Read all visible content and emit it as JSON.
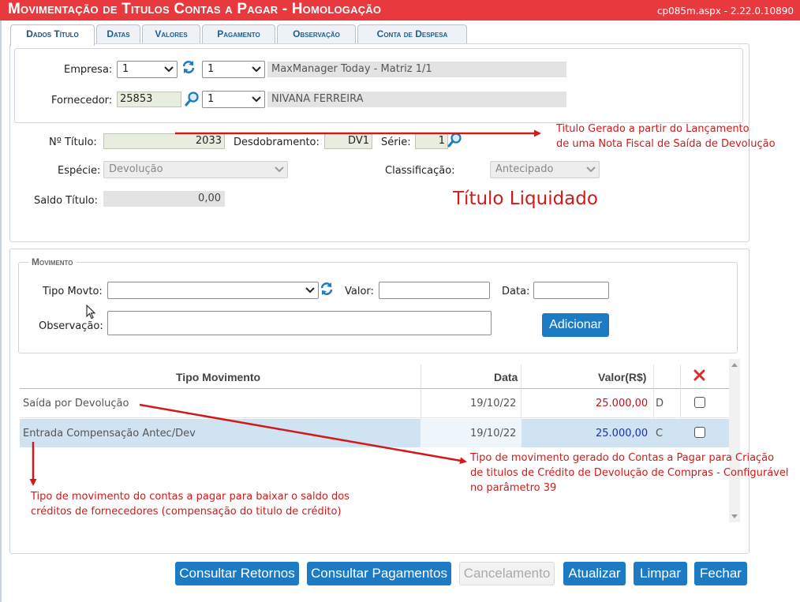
{
  "window": {
    "title": "Movimentação de Titulos Contas a Pagar  - Homologação",
    "version": "cp085m.aspx - 2.22.0.10890"
  },
  "tabs": [
    {
      "label": "Dados Título",
      "active": true
    },
    {
      "label": "Datas"
    },
    {
      "label": "Valores"
    },
    {
      "label": "Pagamento"
    },
    {
      "label": "Observação"
    },
    {
      "label": "Conta de Despesa"
    }
  ],
  "header": {
    "empresa_label": "Empresa:",
    "empresa_value": "1",
    "empresa_filial": "1",
    "empresa_nome": "MaxManager Today - Matriz 1/1",
    "fornecedor_label": "Fornecedor:",
    "fornecedor_codigo": "25853",
    "fornecedor_filial": "1",
    "fornecedor_nome": "NIVANA FERREIRA"
  },
  "titulo": {
    "numero_label": "Nº Título:",
    "numero_value": "2033",
    "desdobramento_label": "Desdobramento:",
    "desdobramento_value": "DV1",
    "serie_label": "Série:",
    "serie_value": "1",
    "especie_label": "Espécie:",
    "especie_value": "Devolução",
    "classificacao_label": "Classificação:",
    "classificacao_value": "Antecipado",
    "saldo_label": "Saldo Título:",
    "saldo_value": "0,00"
  },
  "annotations": {
    "titulo_gerado_1": "Titulo Gerado a partir do Lançamento",
    "titulo_gerado_2": "de uma Nota Fiscal de Saída de Devolução",
    "titulo_liquidado": "Título Liquidado",
    "tipo_criacao_1": "Tipo de movimento gerado do Contas a Pagar para Criação",
    "tipo_criacao_2": "de titulos de Crédito de Devolução de Compras - Configurável",
    "tipo_criacao_3": "no parâmetro 39",
    "tipo_baixa_1": "Tipo de movimento do contas a pagar para baixar o saldo dos",
    "tipo_baixa_2": "créditos de fornecedores (compensação do titulo de crédito)",
    "color": "#d11a1a"
  },
  "movimento": {
    "legend": "Movimento",
    "tipo_label": "Tipo Movto:",
    "tipo_value": "",
    "valor_label": "Valor:",
    "valor_value": "",
    "data_label": "Data:",
    "data_value": "",
    "observacao_label": "Observação:",
    "observacao_value": "",
    "adicionar_label": "Adicionar"
  },
  "table": {
    "columns": [
      "Tipo Movimento",
      "Data",
      "Valor(R$)"
    ],
    "rows": [
      {
        "tipo": "Saída por Devolução",
        "data": "19/10/22",
        "valor": "25.000,00",
        "dc": "D",
        "checked": false,
        "valor_color": "#c0121b"
      },
      {
        "tipo": "Entrada Compensação Antec/Dev",
        "data": "19/10/22",
        "valor": "25.000,00",
        "dc": "C",
        "checked": false,
        "valor_color": "#1a30b0"
      }
    ]
  },
  "buttons": {
    "consultar_retornos": "Consultar Retornos",
    "consultar_pagamentos": "Consultar Pagamentos",
    "cancelamento": "Cancelamento",
    "atualizar": "Atualizar",
    "limpar": "Limpar",
    "fechar": "Fechar"
  },
  "colors": {
    "title_bar": "#e8393f",
    "accent": "#1d7bc3",
    "selected_row": "#cfe3f3"
  }
}
